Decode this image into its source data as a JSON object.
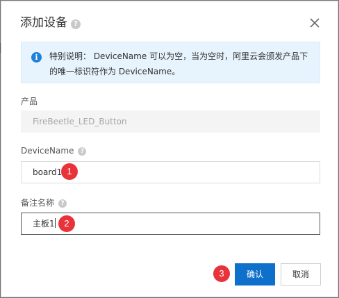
{
  "dialog": {
    "title": "添加设备",
    "title_help": "?",
    "notice": "特别说明： DeviceName 可以为空，当为空时，阿里云会颁发产品下的唯一标识符作为 DeviceName。",
    "info_icon": "i",
    "product": {
      "label": "产品",
      "value": "FireBeetle_LED_Button"
    },
    "device_name": {
      "label": "DeviceName",
      "help": "?",
      "value": "board1"
    },
    "remark": {
      "label": "备注名称",
      "help": "?",
      "value": "主板1"
    },
    "confirm_label": "确认",
    "cancel_label": "取消"
  },
  "annotations": {
    "step1": "1",
    "step2": "2",
    "step3": "3"
  },
  "colors": {
    "primary": "#0f70cc",
    "notice_bg": "#e7f4fd",
    "info_icon": "#1e80d8",
    "step_badge": "#e8333a"
  },
  "icons": {
    "close": "close-icon",
    "info": "info-icon",
    "help": "help-icon"
  }
}
